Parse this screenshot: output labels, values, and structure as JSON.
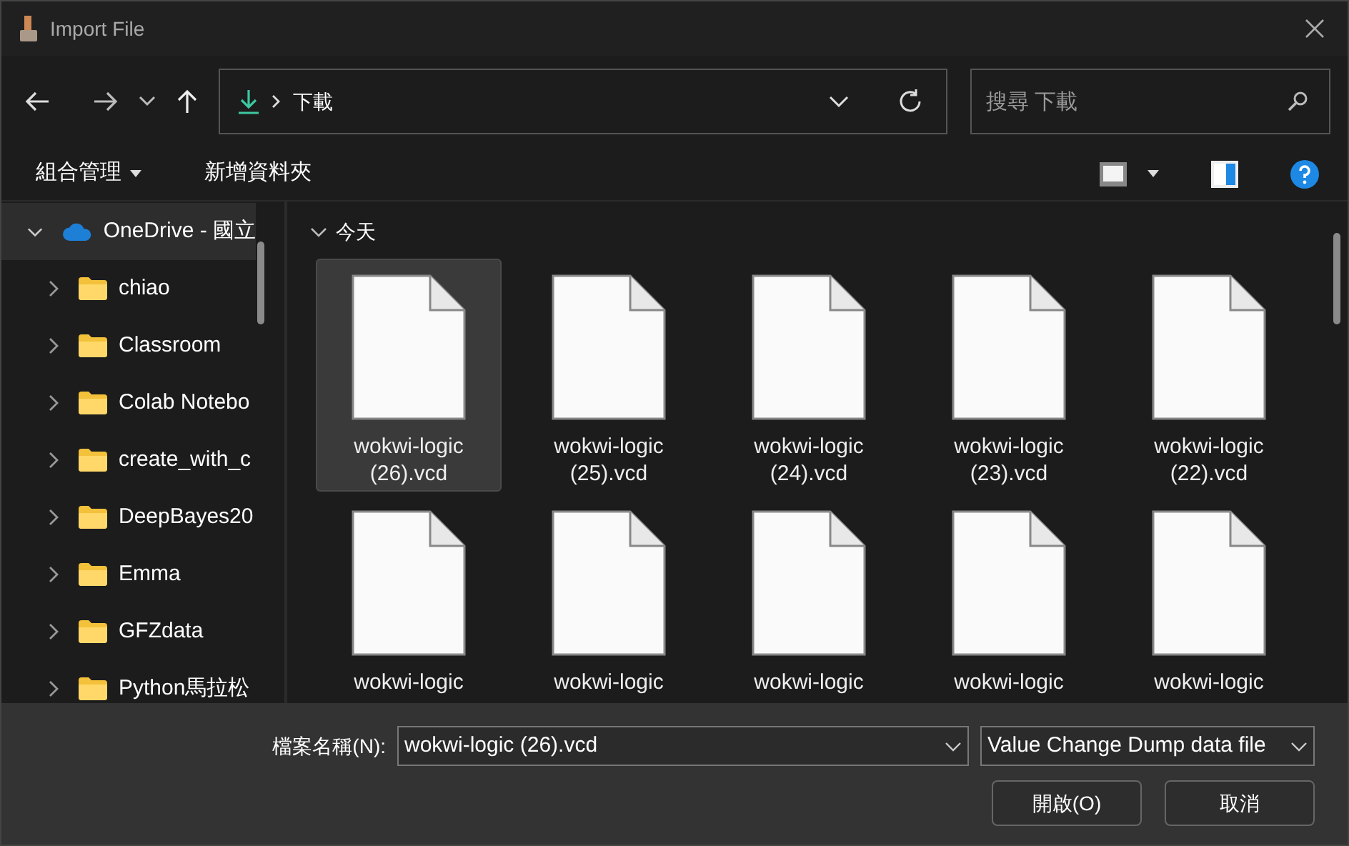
{
  "window": {
    "title": "Import File"
  },
  "address": {
    "path": "下載"
  },
  "search": {
    "placeholder": "搜尋 下載"
  },
  "toolbar": {
    "organize": "組合管理",
    "new_folder": "新增資料夾"
  },
  "sidebar": {
    "items": [
      {
        "label": "OneDrive - 國立",
        "kind": "cloud",
        "expanded": true,
        "selected": true,
        "children": [
          {
            "label": "chiao",
            "kind": "folder",
            "expanded": false,
            "selected": false
          },
          {
            "label": "Classroom",
            "kind": "folder",
            "expanded": false,
            "selected": false
          },
          {
            "label": "Colab Notebo",
            "kind": "folder",
            "expanded": false,
            "selected": false
          },
          {
            "label": "create_with_c",
            "kind": "folder",
            "expanded": false,
            "selected": false
          },
          {
            "label": "DeepBayes20",
            "kind": "folder",
            "expanded": false,
            "selected": false
          },
          {
            "label": "Emma",
            "kind": "folder",
            "expanded": false,
            "selected": false
          },
          {
            "label": "GFZdata",
            "kind": "folder",
            "expanded": false,
            "selected": false
          },
          {
            "label": "Python馬拉松",
            "kind": "folder",
            "expanded": false,
            "selected": false
          }
        ]
      }
    ]
  },
  "group": {
    "label": "今天",
    "expanded": true
  },
  "files": [
    {
      "name": "wokwi-logic (26).vcd",
      "selected": true
    },
    {
      "name": "wokwi-logic (25).vcd",
      "selected": false
    },
    {
      "name": "wokwi-logic (24).vcd",
      "selected": false
    },
    {
      "name": "wokwi-logic (23).vcd",
      "selected": false
    },
    {
      "name": "wokwi-logic (22).vcd",
      "selected": false
    },
    {
      "name": "wokwi-logic",
      "selected": false
    },
    {
      "name": "wokwi-logic",
      "selected": false
    },
    {
      "name": "wokwi-logic",
      "selected": false
    },
    {
      "name": "wokwi-logic",
      "selected": false
    },
    {
      "name": "wokwi-logic",
      "selected": false
    }
  ],
  "footer": {
    "filename_label": "檔案名稱(N):",
    "filename": "wokwi-logic (26).vcd",
    "filetype": "Value Change Dump data file",
    "buttons": [
      "開啟(O)",
      "取消"
    ]
  }
}
